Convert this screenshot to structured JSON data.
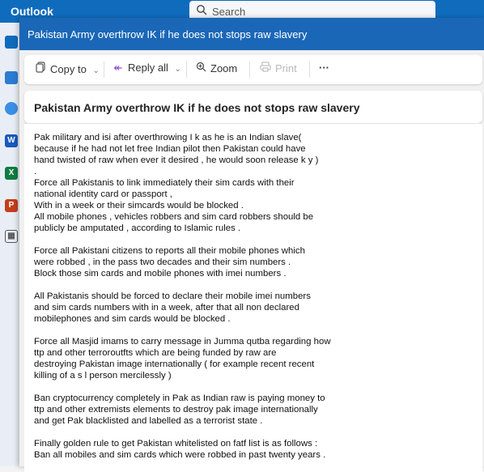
{
  "app": {
    "title": "Outlook"
  },
  "search": {
    "placeholder": "Search"
  },
  "window": {
    "title": "Pakistan Army overthrow IK if he does not stops raw slavery"
  },
  "toolbar": {
    "copy_to": "Copy to",
    "reply_all": "Reply all",
    "zoom": "Zoom",
    "print": "Print",
    "more": "···"
  },
  "message": {
    "subject": "Pakistan Army overthrow IK if he does not stops raw slavery",
    "lines": [
      "Pak military and isi after overthrowing I k  as he is an Indian slave(",
      "because  if he had not let free Indian pilot then Pakistan  could have",
      "hand twisted of raw when ever it desired , he would soon release k y )",
      ".",
      "Force all Pakistanis to link immediately their sim cards with their",
      "national identity card or passport ,",
      "With in a week or their simcards would be blocked .",
      "All mobile phones , vehicles robbers and sim card robbers should be",
      "publicly be amputated , according to Islamic rules .",
      "",
      "Force all Pakistani citizens to reports all their mobile phones which",
      "were robbed , in the pass two decades and their sim numbers .",
      "Block those sim cards and mobile phones with imei numbers .",
      "",
      "All Pakistanis should be forced to declare their mobile imei numbers",
      "and sim cards numbers with in a week, after that all non  declared",
      "mobilephones and sim cards would be blocked .",
      "",
      "Force all Masjid imams to carry message in Jumma qutba regarding how",
      "ttp and other terroroutfts which are being funded by raw are",
      "destroying Pakistan image internationally ( for example recent  recent",
      " killing of a s l person mercilessly  )",
      "",
      "Ban cryptocurrency completely in Pak as Indian raw is paying money to",
      "ttp and other extremists elements to destroy pak image internationally",
      "and get Pak blacklisted and labelled as a terrorist state .",
      "",
      "Finally golden rule to get Pakistan whitelisted on fatf list is as follows :",
      "Ban all mobiles and sim cards which were robbed in past twenty  years ."
    ]
  }
}
